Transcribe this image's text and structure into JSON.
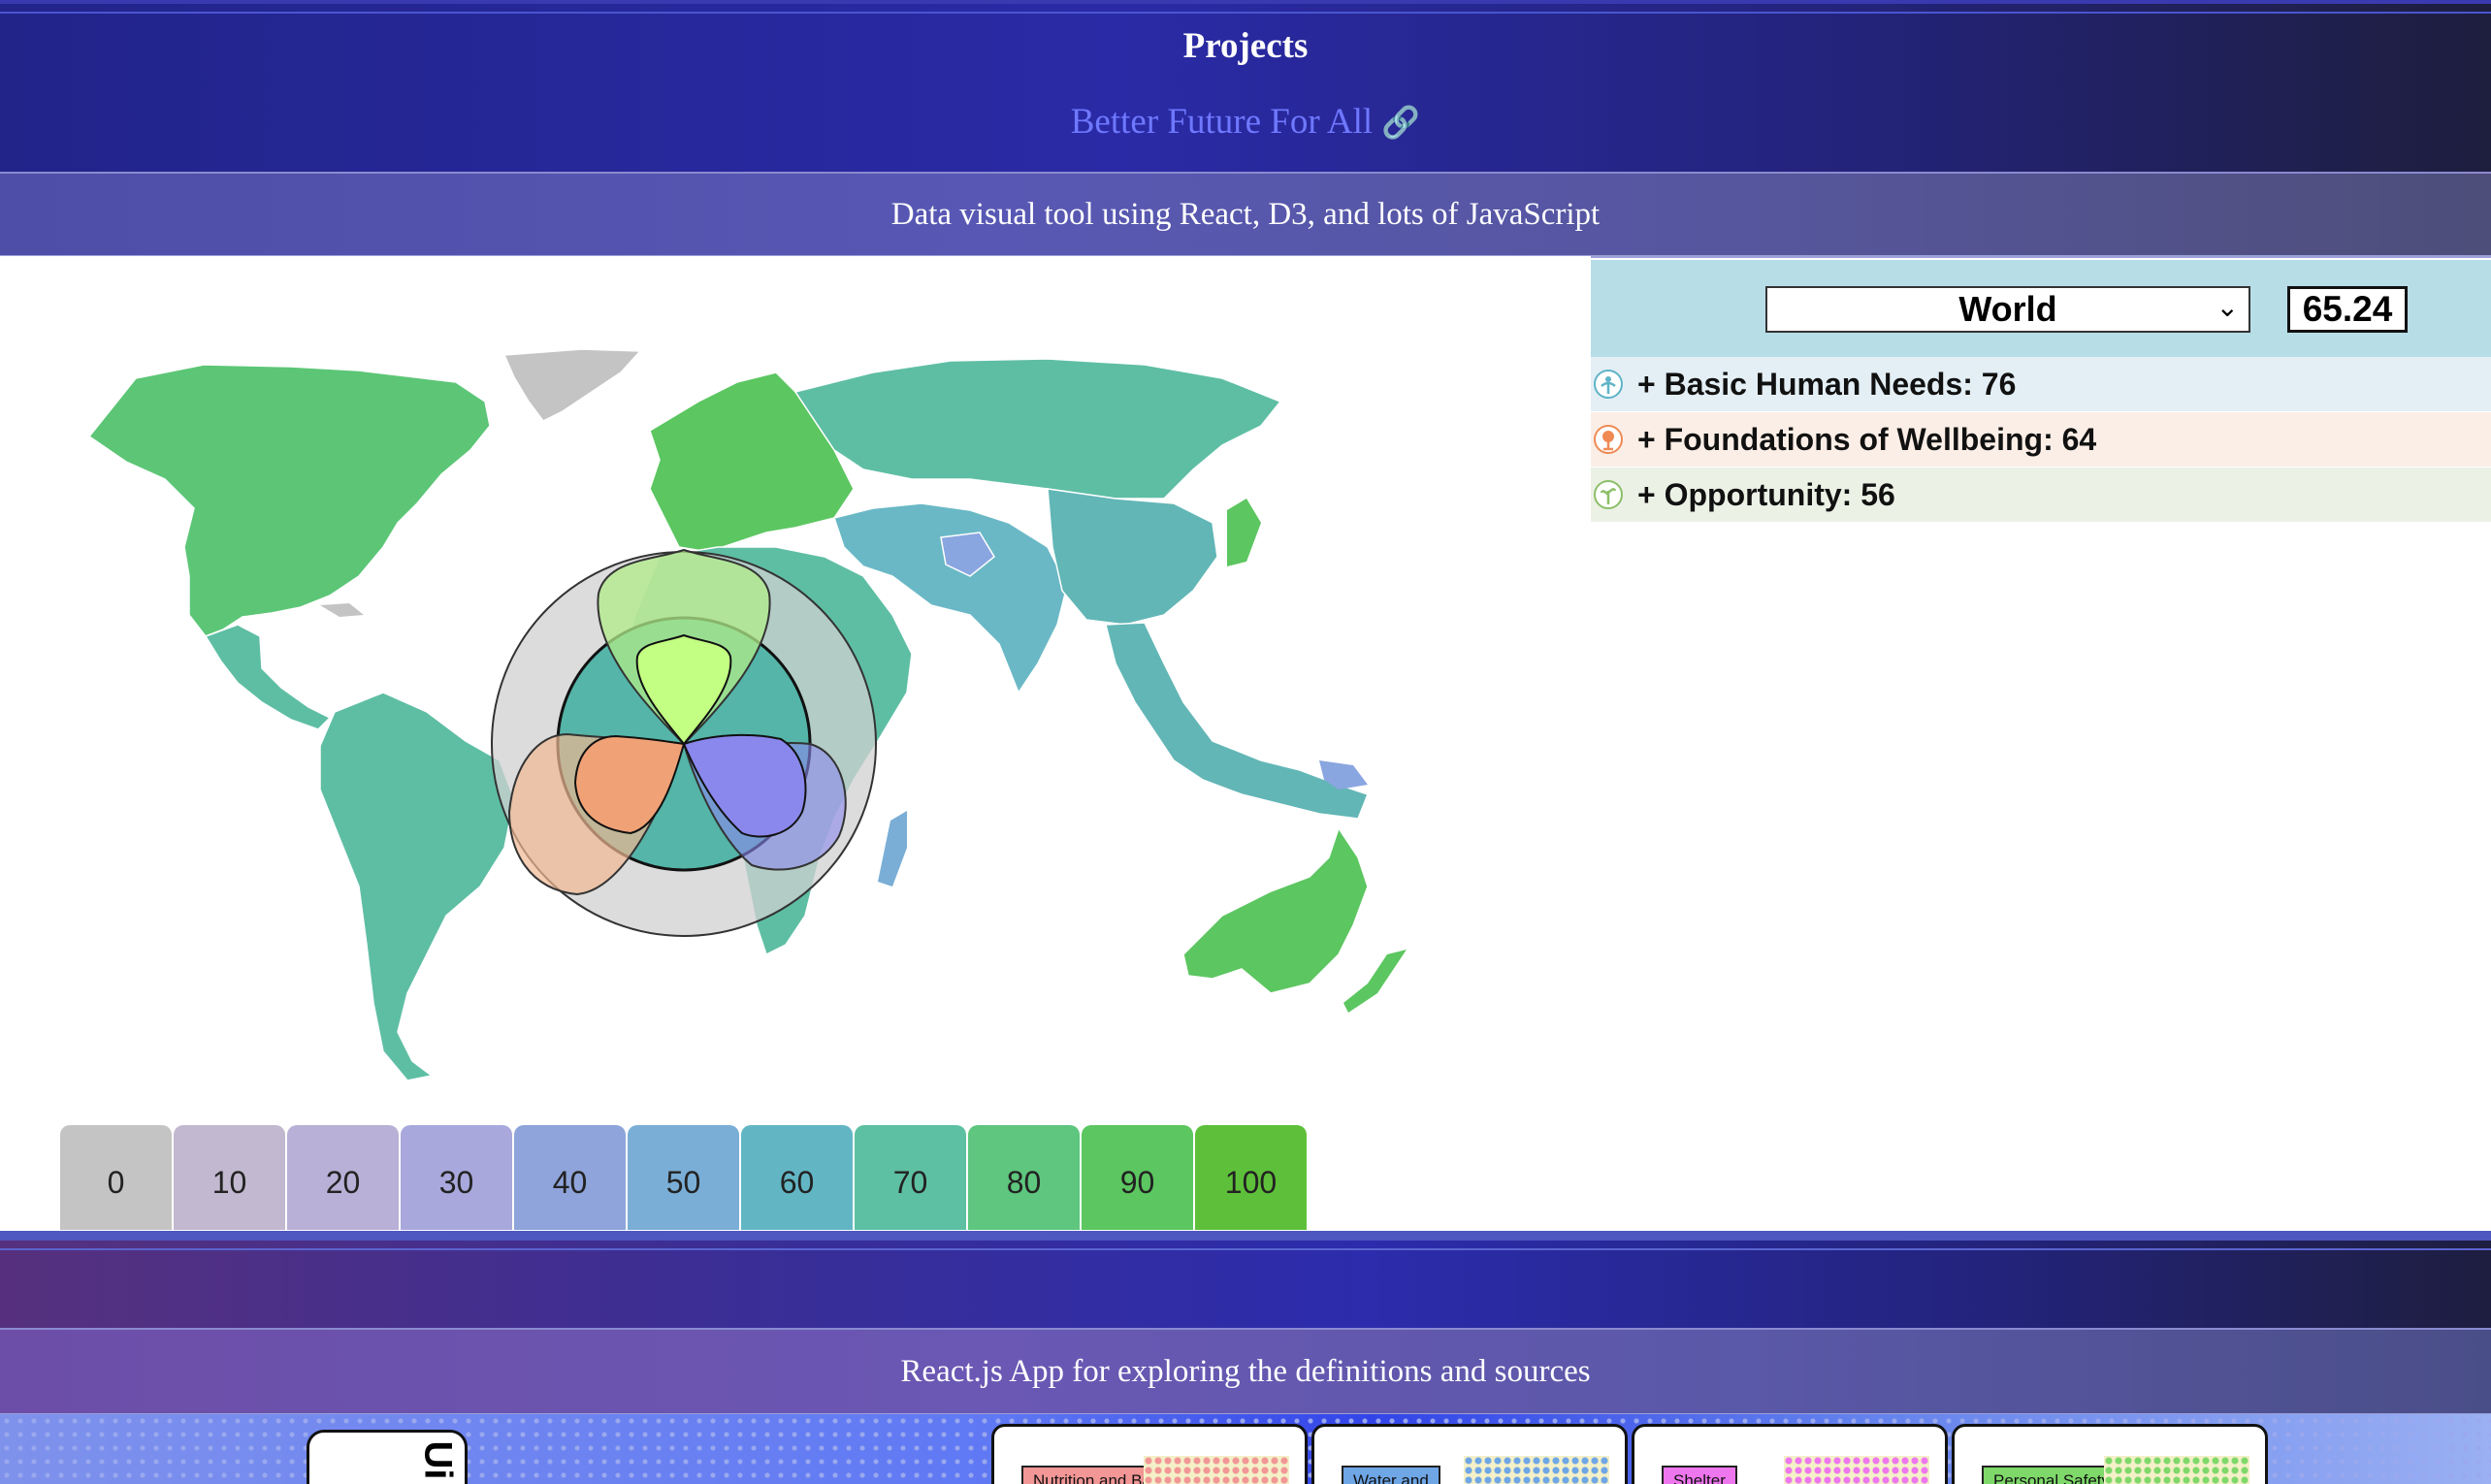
{
  "header": {
    "title": "Projects",
    "link_text": "Better Future For All",
    "link_icon": "🔗",
    "banner_text": "Data visual tool using React, D3, and lots of JavaScript"
  },
  "panel": {
    "region": "World",
    "score": "65.24",
    "categories": [
      {
        "label": "+ Basic Human Needs: 76",
        "color": "#5fb3c7",
        "icon": "basic-human-needs-icon"
      },
      {
        "label": "+ Foundations of Wellbeing: 64",
        "color": "#ef8a55",
        "icon": "foundations-of-wellbeing-icon"
      },
      {
        "label": "+ Opportunity: 56",
        "color": "#8dbf6a",
        "icon": "opportunity-icon"
      }
    ]
  },
  "legend": {
    "labels": [
      "0",
      "10",
      "20",
      "30",
      "40",
      "50",
      "60",
      "70",
      "80",
      "90",
      "100"
    ],
    "colors": [
      "#c4c4c4",
      "#c2b8cf",
      "#b8b0d6",
      "#a8a8dc",
      "#8ea4da",
      "#7aaed6",
      "#62b6c4",
      "#5ec0a2",
      "#5ec67e",
      "#5cc660",
      "#5ec03a"
    ]
  },
  "footer": {
    "banner_text": "React.js App for exploring the definitions and sources",
    "first_card_text": "Ui",
    "cards": [
      {
        "tag": "Nutrition and Basic",
        "color": "#f29696"
      },
      {
        "tag": "Water and",
        "color": "#6ea6e6"
      },
      {
        "tag": "Shelter",
        "color": "#ee76ee"
      },
      {
        "tag": "Personal Safety",
        "color": "#7ed86a"
      }
    ]
  },
  "flower_chart": {
    "petals": [
      {
        "name": "Basic Human Needs",
        "value": 76,
        "color": "#a8f25c"
      },
      {
        "name": "Foundations of Wellbeing",
        "value": 64,
        "color": "#ef9a6e"
      },
      {
        "name": "Opportunity",
        "value": 56,
        "color": "#8a88ec"
      }
    ]
  }
}
